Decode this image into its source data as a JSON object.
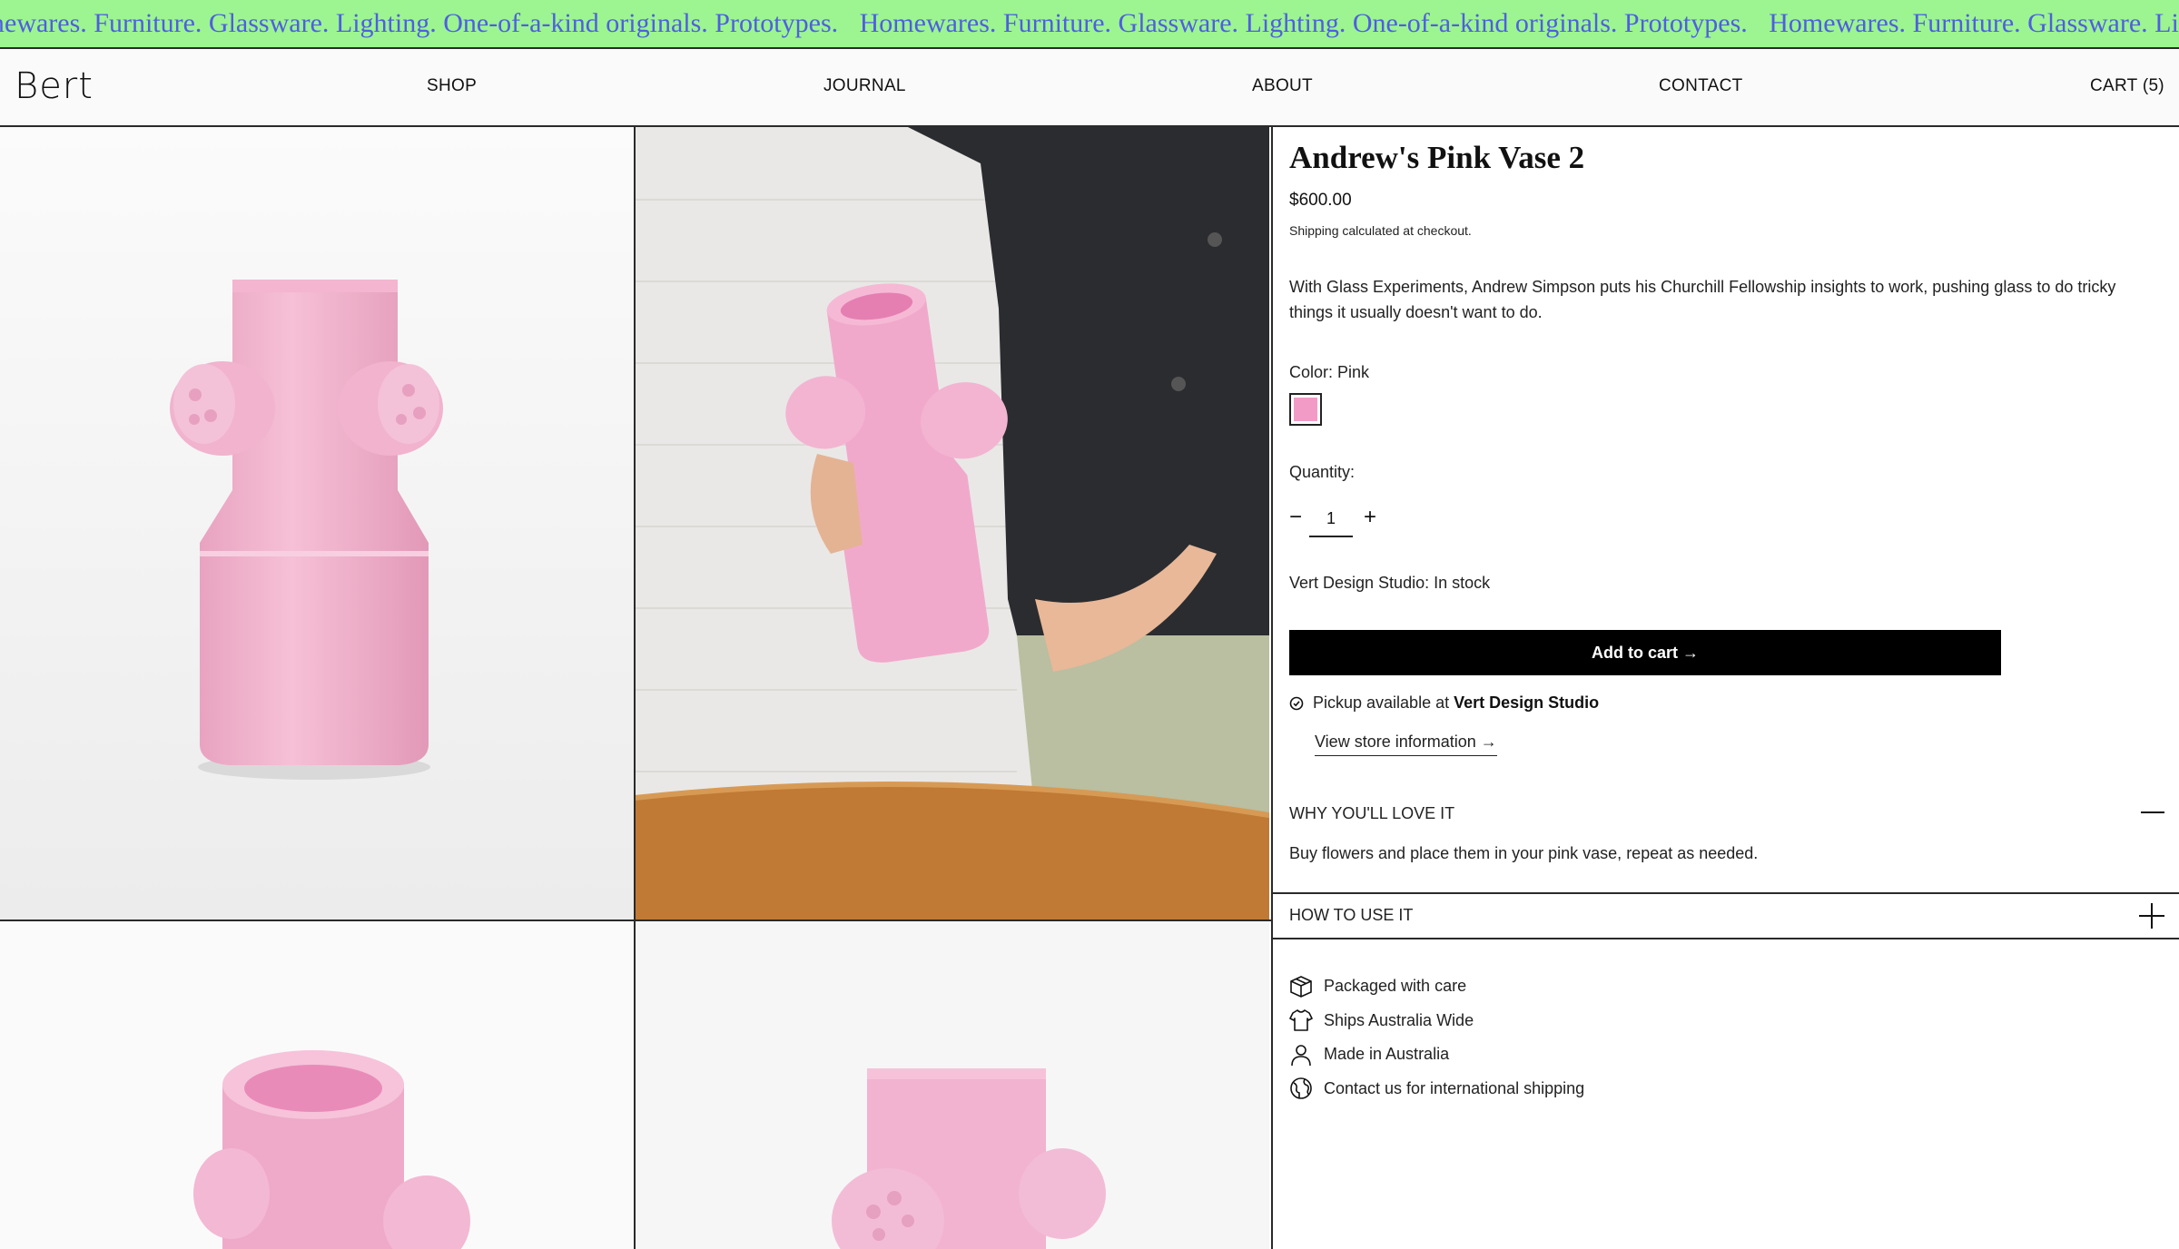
{
  "marquee": {
    "segments": [
      "Homewares. Furniture. Glassware. Lighting. One-of-a-kind originals. Prototypes.",
      "Homewares. Furniture. Glassware. Lighting. One-of-a-kind originals. Prototypes.",
      "Homewares. Furniture. Glassware. Lighting. One-of-a-kind originals. Prototypes."
    ],
    "background": "#9cf591",
    "text_color": "#4f5ee0"
  },
  "header": {
    "logo": "Bert",
    "nav": {
      "shop": "SHOP",
      "journal": "JOURNAL",
      "about": "ABOUT",
      "contact": "CONTACT",
      "cart": "CART (5)"
    }
  },
  "gallery": {
    "images": [
      {
        "alt": "pink-vase-front-icon"
      },
      {
        "alt": "pink-vase-held-icon"
      },
      {
        "alt": "pink-vase-top-icon"
      },
      {
        "alt": "pink-vase-side-icon"
      }
    ]
  },
  "product": {
    "title": "Andrew's Pink Vase 2",
    "price": "$600.00",
    "shipping_note": "Shipping calculated at checkout.",
    "description": "With Glass Experiments, Andrew Simpson puts his Churchill Fellowship insights to work, pushing glass to do tricky things it usually doesn't want to do.",
    "color_label": "Color: Pink",
    "swatch_color": "#f39bc7",
    "quantity_label": "Quantity:",
    "quantity_value": "1",
    "stock": "Vert Design Studio: In stock",
    "add_to_cart": "Add to cart →",
    "pickup_prefix": "Pickup available at ",
    "pickup_store": "Vert Design Studio",
    "store_link": "View store information →"
  },
  "accordion": {
    "love": {
      "title": "WHY YOU'LL LOVE IT",
      "toggle": "—",
      "body": "Buy flowers and place them in your pink vase, repeat as needed."
    },
    "use": {
      "title": "HOW TO USE IT",
      "toggle": "+"
    }
  },
  "features": [
    {
      "icon": "box-icon",
      "label": "Packaged with care"
    },
    {
      "icon": "shirt-icon",
      "label": "Ships Australia Wide"
    },
    {
      "icon": "person-icon",
      "label": "Made in Australia"
    },
    {
      "icon": "globe-icon",
      "label": "Contact us for international shipping"
    }
  ]
}
